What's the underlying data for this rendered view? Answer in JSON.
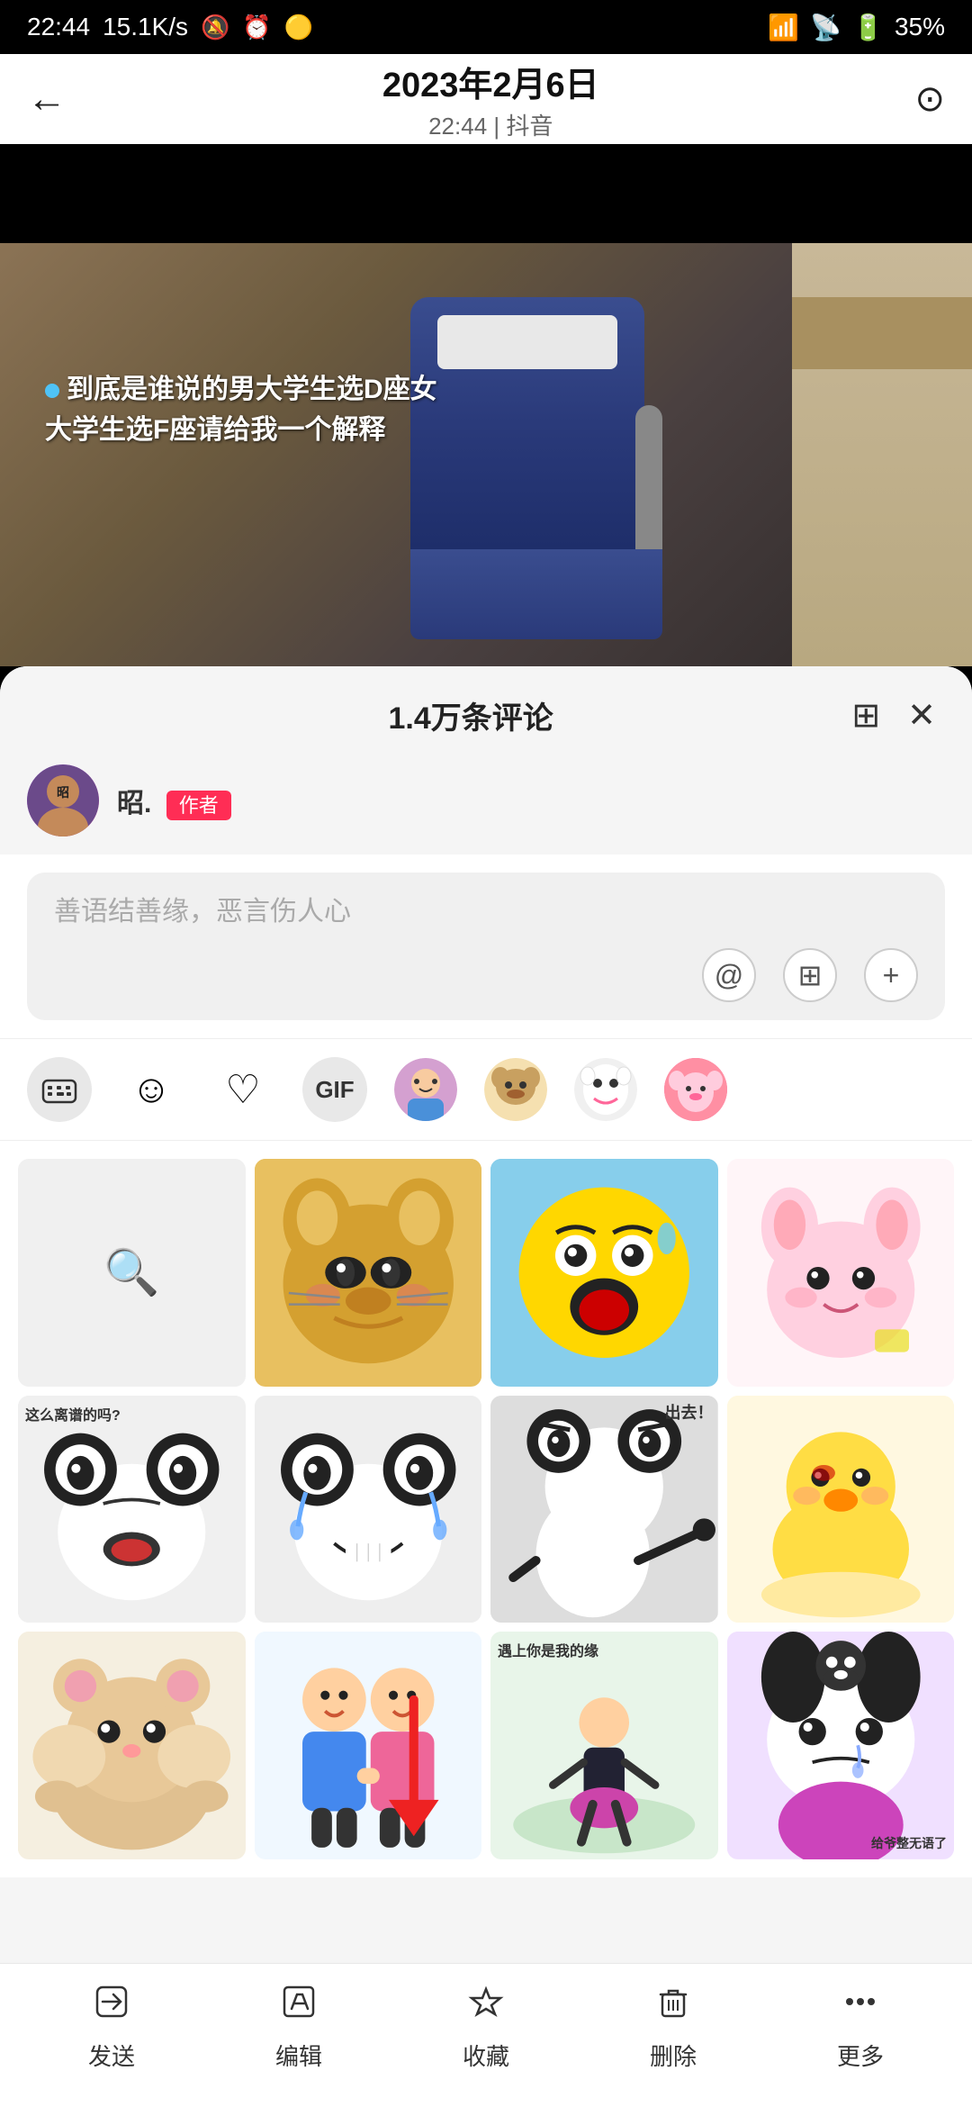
{
  "statusBar": {
    "time": "22:44",
    "speed": "15.1K/s",
    "battery": "35%"
  },
  "header": {
    "backLabel": "←",
    "date": "2023年2月6日",
    "subtitle": "22:44 | 抖音",
    "icon": "⊙"
  },
  "video": {
    "overlayText": "到底是谁说的男大学生选D座女\n大学生选F座请给我一个解释",
    "dotColor": "#4fc3f7"
  },
  "commentPanel": {
    "title": "1.4万条评论",
    "expandIcon": "⊞",
    "closeIcon": "✕",
    "authorName": "昭.",
    "authorBadge": "作者"
  },
  "inputArea": {
    "placeholder": "善语结善缘，恶言伤人心",
    "atIcon": "@",
    "keyboardIcon": "⊞",
    "plusIcon": "+"
  },
  "emojiToolbar": {
    "keyboardIcon": "⊟",
    "emojiIcon": "☺",
    "heartIcon": "♡",
    "gifLabel": "GIF",
    "stickers": [
      "🧑",
      "🐻",
      "🐱",
      "🐷"
    ]
  },
  "bottomBar": {
    "send": "发送",
    "edit": "编辑",
    "collect": "收藏",
    "delete": "删除",
    "more": "更多"
  },
  "stickers": {
    "row1": [
      {
        "type": "search",
        "label": "搜索"
      },
      {
        "type": "cat-funny",
        "label": "搞笑猫"
      },
      {
        "type": "scared",
        "label": "惊恐"
      },
      {
        "type": "pink-cat",
        "label": "粉猫"
      }
    ],
    "row2": [
      {
        "type": "panda-question",
        "label": "这么离谱的吗?"
      },
      {
        "type": "panda-cry",
        "label": "熊猫哭泣"
      },
      {
        "type": "panda-out",
        "label": "出去!"
      },
      {
        "type": "duck",
        "label": "小黄鸭"
      }
    ],
    "row3": [
      {
        "type": "hamster",
        "label": "仓鼠"
      },
      {
        "type": "couple",
        "label": "情侣"
      },
      {
        "type": "encounter",
        "label": "遇上你是我的缘"
      },
      {
        "type": "kuromi",
        "label": "库洛米"
      }
    ]
  }
}
